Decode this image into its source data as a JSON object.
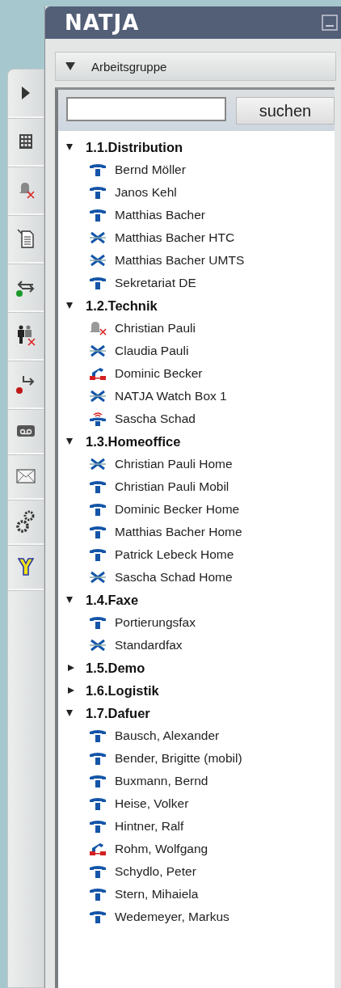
{
  "window": {
    "logo": "NATJA"
  },
  "section": {
    "title": "Arbeitsgruppe",
    "expanded": true
  },
  "search": {
    "button": "suchen"
  },
  "groups": [
    {
      "name": "1.1.Distribution",
      "expanded": true,
      "children": [
        {
          "name": "Bernd Möller",
          "kind": "phone"
        },
        {
          "name": "Janos Kehl",
          "kind": "phone"
        },
        {
          "name": "Matthias Bacher",
          "kind": "phone"
        },
        {
          "name": "Matthias Bacher HTC",
          "kind": "offline"
        },
        {
          "name": "Matthias Bacher UMTS",
          "kind": "offline"
        },
        {
          "name": "Sekretariat DE",
          "kind": "phone"
        }
      ]
    },
    {
      "name": "1.2.Technik",
      "expanded": true,
      "children": [
        {
          "name": "Christian Pauli",
          "kind": "muted"
        },
        {
          "name": "Claudia Pauli",
          "kind": "offline"
        },
        {
          "name": "Dominic Becker",
          "kind": "busy"
        },
        {
          "name": "NATJA Watch Box 1",
          "kind": "offline"
        },
        {
          "name": "Sascha Schad",
          "kind": "ringing"
        }
      ]
    },
    {
      "name": "1.3.Homeoffice",
      "expanded": true,
      "children": [
        {
          "name": "Christian Pauli Home",
          "kind": "offline"
        },
        {
          "name": "Christian Pauli Mobil",
          "kind": "phone"
        },
        {
          "name": "Dominic Becker Home",
          "kind": "phone"
        },
        {
          "name": "Matthias Bacher Home",
          "kind": "phone"
        },
        {
          "name": "Patrick Lebeck Home",
          "kind": "phone"
        },
        {
          "name": "Sascha Schad Home",
          "kind": "offline"
        }
      ]
    },
    {
      "name": "1.4.Faxe",
      "expanded": true,
      "children": [
        {
          "name": "Portierungsfax",
          "kind": "phone"
        },
        {
          "name": "Standardfax",
          "kind": "offline"
        }
      ]
    },
    {
      "name": "1.5.Demo",
      "expanded": false
    },
    {
      "name": "1.6.Logistik",
      "expanded": false
    },
    {
      "name": "1.7.Dafuer",
      "expanded": true,
      "children": [
        {
          "name": "Bausch, Alexander",
          "kind": "phone"
        },
        {
          "name": "Bender, Brigitte (mobil)",
          "kind": "phone"
        },
        {
          "name": "Buxmann, Bernd",
          "kind": "phone"
        },
        {
          "name": "Heise, Volker",
          "kind": "phone"
        },
        {
          "name": "Hintner, Ralf",
          "kind": "phone"
        },
        {
          "name": "Rohm, Wolfgang",
          "kind": "busy"
        },
        {
          "name": "Schydlo, Peter",
          "kind": "phone"
        },
        {
          "name": "Stern, Mihaiela",
          "kind": "phone"
        },
        {
          "name": "Wedemeyer, Markus",
          "kind": "phone"
        }
      ]
    }
  ]
}
